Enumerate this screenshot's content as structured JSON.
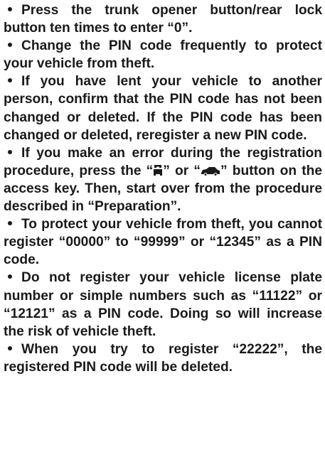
{
  "items": [
    {
      "text": "Press the trunk opener button/rear lock button ten times to enter “0”."
    },
    {
      "text": "Change the PIN code frequently to protect your vehicle from theft."
    },
    {
      "text": "If you have lent your vehicle to another person, confirm that the PIN code has not been changed or deleted. If the PIN code has been changed or deleted, reregister a new PIN code."
    },
    {
      "before_icon_1": "If you make an error during the registration procedure, press the “",
      "icon_1": "trunk-open-icon",
      "between_icons": "” or “",
      "icon_2": "car-lock-icon",
      "after_icon_2": "” button on the access key. Then, start over from the procedure described in “Preparation”."
    },
    {
      "text": "To protect your vehicle from theft, you cannot register “00000” to “99999” or “12345” as a PIN code."
    },
    {
      "text": "Do not register your vehicle license plate number or simple numbers such as “11122” or “12121” as a PIN code. Doing so will increase the risk of vehicle theft."
    },
    {
      "text": "When you try to register “22222”, the registered PIN code will be deleted."
    }
  ]
}
